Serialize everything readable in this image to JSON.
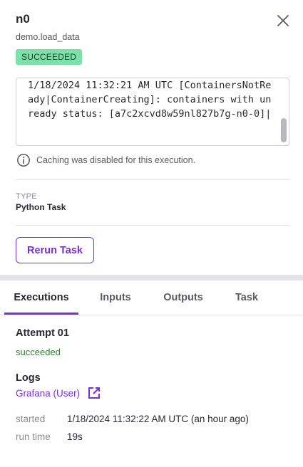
{
  "header": {
    "title": "n0",
    "subtitle": "demo.load_data",
    "status": "SUCCEEDED",
    "close_icon": "close-icon"
  },
  "log": {
    "text": "1/18/2024 11:32:21 AM UTC [ContainersNotReady|ContainerCreating]: containers with unready status: [a7c2xcvd8w59nl827b7g-n0-0]|"
  },
  "cache_note": {
    "icon": "info-icon",
    "text": "Caching was disabled for this execution."
  },
  "type_section": {
    "label": "TYPE",
    "value": "Python Task"
  },
  "rerun_button": "Rerun Task",
  "tabs": [
    {
      "label": "Executions",
      "active": true
    },
    {
      "label": "Inputs",
      "active": false
    },
    {
      "label": "Outputs",
      "active": false
    },
    {
      "label": "Task",
      "active": false
    }
  ],
  "execution": {
    "attempt_title": "Attempt 01",
    "attempt_status": "succeeded",
    "logs_title": "Logs",
    "log_link": "Grafana (User)",
    "log_link_icon": "external-link-icon",
    "started_label": "started",
    "started_value": "1/18/2024 11:32:22 AM UTC (an hour ago)",
    "runtime_label": "run time",
    "runtime_value": "19s"
  },
  "colors": {
    "accent": "#7a2fd6",
    "success_badge": "#7de0a8",
    "success_text": "#2f7d32"
  }
}
